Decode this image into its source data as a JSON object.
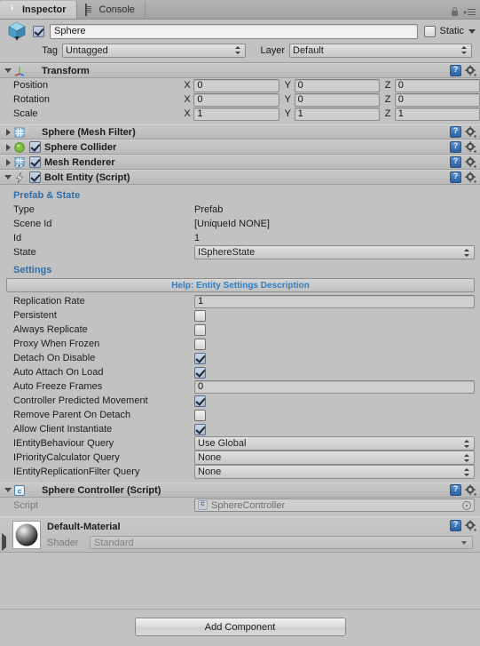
{
  "window": {
    "tabs": [
      {
        "label": "Inspector",
        "icon": "info-icon",
        "active": true
      },
      {
        "label": "Console",
        "icon": "console-icon",
        "active": false
      }
    ],
    "lock_icon": "lock-icon",
    "menu_icon": "hamburger-menu-icon"
  },
  "gameobject": {
    "icon": "cube-icon",
    "enabled": true,
    "name": "Sphere",
    "static_label": "Static",
    "static_checked": false,
    "tag_label": "Tag",
    "tag_value": "Untagged",
    "layer_label": "Layer",
    "layer_value": "Default"
  },
  "components": [
    {
      "id": "transform",
      "title": "Transform",
      "icon": "transform-axis-icon",
      "expanded": true,
      "has_checkbox": false,
      "rows": [
        {
          "label": "Position",
          "x": "0",
          "y": "0",
          "z": "0"
        },
        {
          "label": "Rotation",
          "x": "0",
          "y": "0",
          "z": "0"
        },
        {
          "label": "Scale",
          "x": "1",
          "y": "1",
          "z": "1"
        }
      ],
      "axis_labels": [
        "X",
        "Y",
        "Z"
      ]
    },
    {
      "id": "mesh-filter",
      "title": "Sphere (Mesh Filter)",
      "icon": "mesh-filter-icon",
      "expanded": false,
      "has_checkbox": false
    },
    {
      "id": "sphere-collider",
      "title": "Sphere Collider",
      "icon": "sphere-collider-icon",
      "expanded": false,
      "has_checkbox": true,
      "checked": true
    },
    {
      "id": "mesh-renderer",
      "title": "Mesh Renderer",
      "icon": "mesh-renderer-icon",
      "expanded": false,
      "has_checkbox": true,
      "checked": true
    },
    {
      "id": "bolt-entity",
      "title": "Bolt Entity (Script)",
      "icon": "bolt-lightning-icon",
      "expanded": true,
      "has_checkbox": true,
      "checked": true
    },
    {
      "id": "sphere-controller",
      "title": "Sphere Controller (Script)",
      "icon": "csharp-script-icon",
      "expanded": true,
      "has_checkbox": false
    }
  ],
  "bolt_entity": {
    "prefab_state_heading": "Prefab & State",
    "type_label": "Type",
    "type_value": "Prefab",
    "scene_id_label": "Scene Id",
    "scene_id_value": "[UniqueId NONE]",
    "id_label": "Id",
    "id_value": "1",
    "state_label": "State",
    "state_value": "ISphereState",
    "settings_heading": "Settings",
    "help_text": "Help: Entity Settings Description",
    "settings": [
      {
        "label": "Replication Rate",
        "type": "text",
        "value": "1"
      },
      {
        "label": "Persistent",
        "type": "checkbox",
        "checked": false
      },
      {
        "label": "Always Replicate",
        "type": "checkbox",
        "checked": false
      },
      {
        "label": "Proxy When Frozen",
        "type": "checkbox",
        "checked": false
      },
      {
        "label": "Detach On Disable",
        "type": "checkbox",
        "checked": true
      },
      {
        "label": "Auto Attach On Load",
        "type": "checkbox",
        "checked": true
      },
      {
        "label": "Auto Freeze Frames",
        "type": "text",
        "value": "0"
      },
      {
        "label": "Controller Predicted Movement",
        "type": "checkbox",
        "checked": true
      },
      {
        "label": "Remove Parent On Detach",
        "type": "checkbox",
        "checked": false
      },
      {
        "label": "Allow Client Instantiate",
        "type": "checkbox",
        "checked": true
      },
      {
        "label": "IEntityBehaviour Query",
        "type": "dropdown",
        "value": "Use Global"
      },
      {
        "label": "IPriorityCalculator Query",
        "type": "dropdown",
        "value": "None"
      },
      {
        "label": "IEntityReplicationFilter Query",
        "type": "dropdown",
        "value": "None"
      }
    ]
  },
  "sphere_controller": {
    "script_label": "Script",
    "script_value": "SphereController"
  },
  "material": {
    "name": "Default-Material",
    "shader_label": "Shader",
    "shader_value": "Standard",
    "thumb_icon": "sphere-preview-icon"
  },
  "footer": {
    "add_component_label": "Add Component"
  },
  "colors": {
    "accent_blue": "#2f6ea8",
    "help_blue": "#2f7fc4",
    "panel_bg": "#c2c2c2",
    "header_bg": "#bababa"
  }
}
